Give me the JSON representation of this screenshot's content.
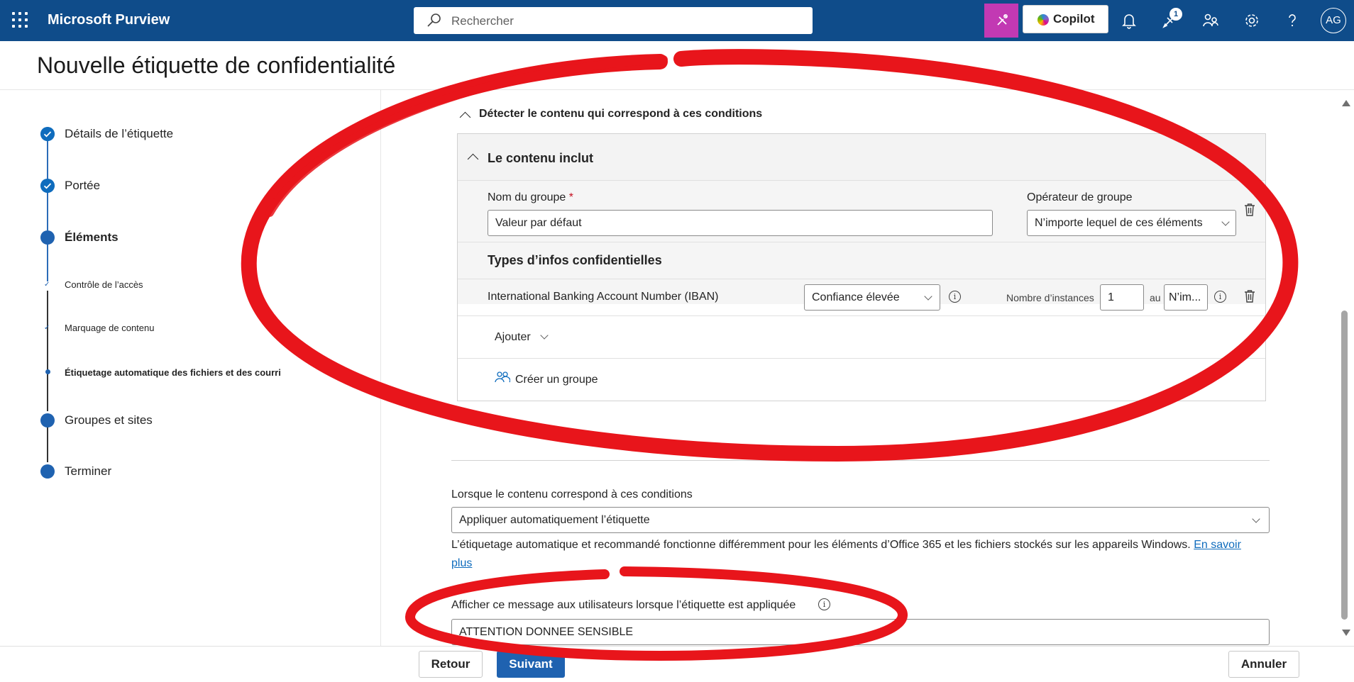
{
  "app": {
    "name": "Microsoft Purview",
    "search_placeholder": "Rechercher",
    "copilot_label": "Copilot",
    "notification_count": "1",
    "avatar_initials": "AG"
  },
  "page": {
    "title": "Nouvelle étiquette de confidentialité"
  },
  "steps": [
    {
      "label": "Détails de l’étiquette",
      "state": "done"
    },
    {
      "label": "Portée",
      "state": "done"
    },
    {
      "label": "Éléments",
      "state": "current"
    },
    {
      "label": "Contrôle de l’accès",
      "state": "sub-done"
    },
    {
      "label": "Marquage de contenu",
      "state": "sub-done"
    },
    {
      "label": "Étiquetage automatique des fichiers et des courri",
      "state": "sub-current"
    },
    {
      "label": "Groupes et sites",
      "state": "todo"
    },
    {
      "label": "Terminer",
      "state": "todo"
    }
  ],
  "conditions": {
    "detect_heading": "Détecter le contenu qui correspond à ces conditions",
    "content_includes": "Le contenu inclut",
    "group_name_label": "Nom du groupe",
    "group_name_required": "*",
    "group_name_value": "Valeur par défaut",
    "group_operator_label": "Opérateur de groupe",
    "group_operator_value": "N’importe lequel de ces éléments",
    "types_title": "Types d’infos confidentielles",
    "sit_row": {
      "name": "International Banking Account Number (IBAN)",
      "confidence": "Confiance élevée",
      "instances_label": "Nombre d’instances",
      "min_value": "1",
      "to_label": "au",
      "max_value": "N’im..."
    },
    "add_label": "Ajouter",
    "create_group_label": "Créer un groupe"
  },
  "action": {
    "when_label": "Lorsque le contenu correspond à ces conditions",
    "when_value": "Appliquer automatiquement l’étiquette",
    "description": "L’étiquetage automatique et recommandé fonctionne différemment pour les éléments d’Office 365 et les fichiers stockés sur les appareils Windows.",
    "learn_more": "En savoir plus",
    "message_label": "Afficher ce message aux utilisateurs lorsque l’étiquette est appliquée",
    "message_value": "ATTENTION DONNEE SENSIBLE"
  },
  "footer": {
    "back": "Retour",
    "next": "Suivant",
    "cancel": "Annuler"
  },
  "colors": {
    "topbar": "#0f4c8a",
    "accent": "#1f62b0",
    "annotation": "#e8151b",
    "copilot_tile": "#c239b3"
  }
}
